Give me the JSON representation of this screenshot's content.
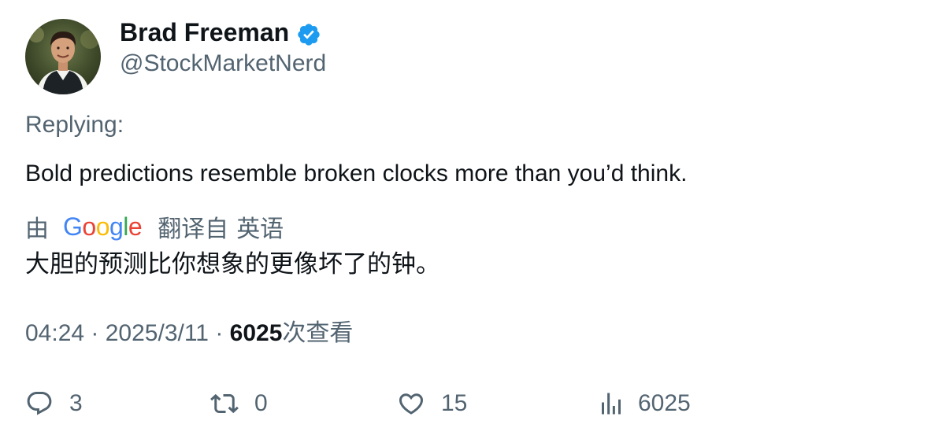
{
  "author": {
    "display_name": "Brad Freeman",
    "handle": "@StockMarketNerd",
    "verified": true
  },
  "replying_label": "Replying:",
  "tweet_text": "Bold predictions resemble broken clocks more than you’d think.",
  "translation": {
    "by_label": "由",
    "provider_letters": [
      "G",
      "o",
      "o",
      "g",
      "l",
      "e"
    ],
    "provider_colors": [
      "#4285F4",
      "#EA4335",
      "#FBBC05",
      "#4285F4",
      "#34A853",
      "#EA4335"
    ],
    "translated_from_label": "翻译自",
    "source_language": "英语",
    "translated_text": "大胆的预测比你想象的更像坏了的钟。"
  },
  "meta": {
    "time": "04:24",
    "separator": "·",
    "date": "2025/3/11",
    "views_count": "6025",
    "views_label": "次查看"
  },
  "actions": {
    "reply_count": "3",
    "retweet_count": "0",
    "like_count": "15",
    "views_count": "6025"
  },
  "colors": {
    "verified_badge": "#1d9bf0",
    "secondary_text": "#536471",
    "primary_text": "#0f1419"
  },
  "icons": [
    "verified-badge-icon",
    "reply-icon",
    "retweet-icon",
    "like-icon",
    "views-icon"
  ]
}
